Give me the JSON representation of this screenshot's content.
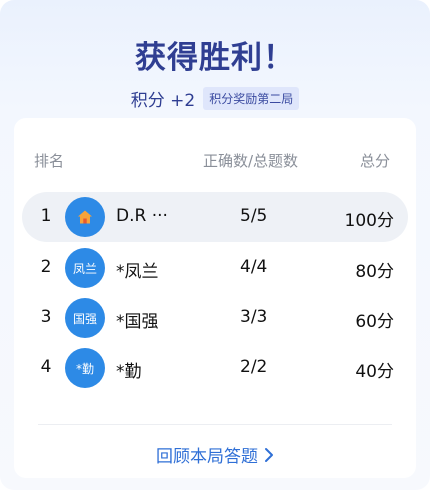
{
  "header": {
    "title": "获得胜利！",
    "score": "积分 +2",
    "tag": "积分奖励第二局"
  },
  "table": {
    "columns": [
      "排名",
      "正确数/总题数",
      "总分"
    ],
    "rows": [
      {
        "rank": "1",
        "avatar_text": "",
        "avatar_icon": "home-icon",
        "name": "D.R ···",
        "ratio": "5/5",
        "total": "100分"
      },
      {
        "rank": "2",
        "avatar_text": "凤兰",
        "name": "*凤兰",
        "ratio": "4/4",
        "total": "80分"
      },
      {
        "rank": "3",
        "avatar_text": "国强",
        "name": "*国强",
        "ratio": "3/3",
        "total": "60分"
      },
      {
        "rank": "4",
        "avatar_text": "*勤",
        "name": "*勤",
        "ratio": "2/2",
        "total": "40分"
      }
    ]
  },
  "footer": {
    "review_label": "回顾本局答题"
  },
  "colors": {
    "title": "#2f3e92",
    "accent": "#2d8ae6",
    "link": "#2f6fd6"
  }
}
